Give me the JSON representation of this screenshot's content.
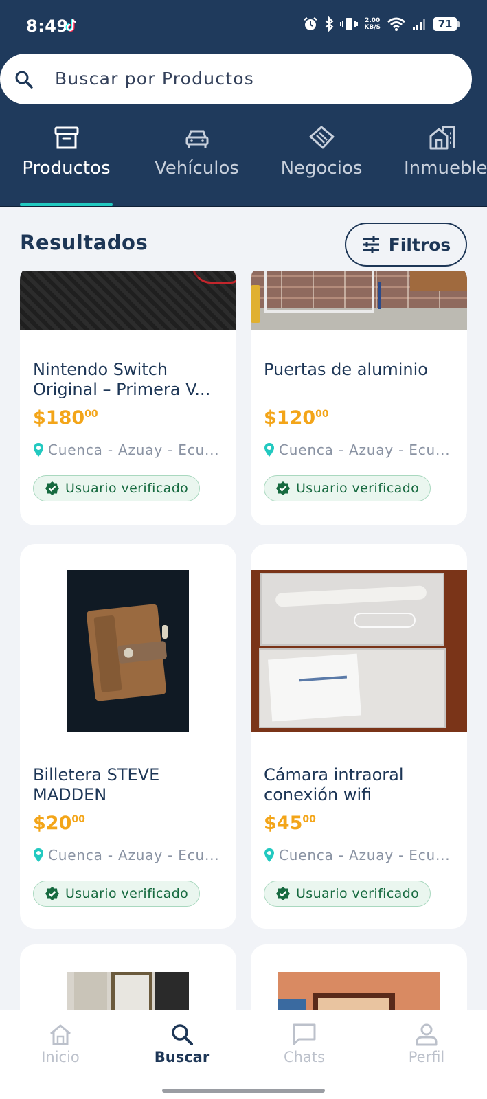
{
  "status_bar": {
    "time": "8:49",
    "net_speed_value": "2.00",
    "net_speed_unit": "KB/S",
    "battery": "71"
  },
  "search": {
    "placeholder": "Buscar por Productos"
  },
  "categories": [
    {
      "label": "Productos",
      "icon": "archive-box-icon",
      "active": true
    },
    {
      "label": "Vehículos",
      "icon": "car-icon",
      "active": false
    },
    {
      "label": "Negocios",
      "icon": "handshake-icon",
      "active": false
    },
    {
      "label": "Inmuebles",
      "icon": "building-icon",
      "active": false
    }
  ],
  "results": {
    "title": "Resultados",
    "filter_label": "Filtros"
  },
  "products": [
    {
      "title": "Nintendo Switch Original – Primera V...",
      "price_main": "$180",
      "price_cents": "00",
      "location": "Cuenca - Azuay - Ecu...",
      "badge": "Usuario verificado"
    },
    {
      "title": "Puertas de aluminio",
      "price_main": "$120",
      "price_cents": "00",
      "location": "Cuenca - Azuay - Ecu...",
      "badge": "Usuario verificado"
    },
    {
      "title": "Billetera STEVE MADDEN",
      "price_main": "$20",
      "price_cents": "00",
      "location": "Cuenca - Azuay - Ecu...",
      "badge": "Usuario verificado"
    },
    {
      "title": "Cámara intraoral conexión wifi",
      "price_main": "$45",
      "price_cents": "00",
      "location": "Cuenca - Azuay - Ecu...",
      "badge": "Usuario verificado"
    }
  ],
  "colors": {
    "header": "#1f3a5c",
    "accent_teal": "#22c9c0",
    "price": "#f3a519",
    "verified_green": "#176a40"
  },
  "bottom_nav": [
    {
      "label": "Inicio",
      "icon": "home-icon",
      "active": false
    },
    {
      "label": "Buscar",
      "icon": "search-icon",
      "active": true
    },
    {
      "label": "Chats",
      "icon": "chat-icon",
      "active": false
    },
    {
      "label": "Perfil",
      "icon": "user-icon",
      "active": false
    }
  ]
}
